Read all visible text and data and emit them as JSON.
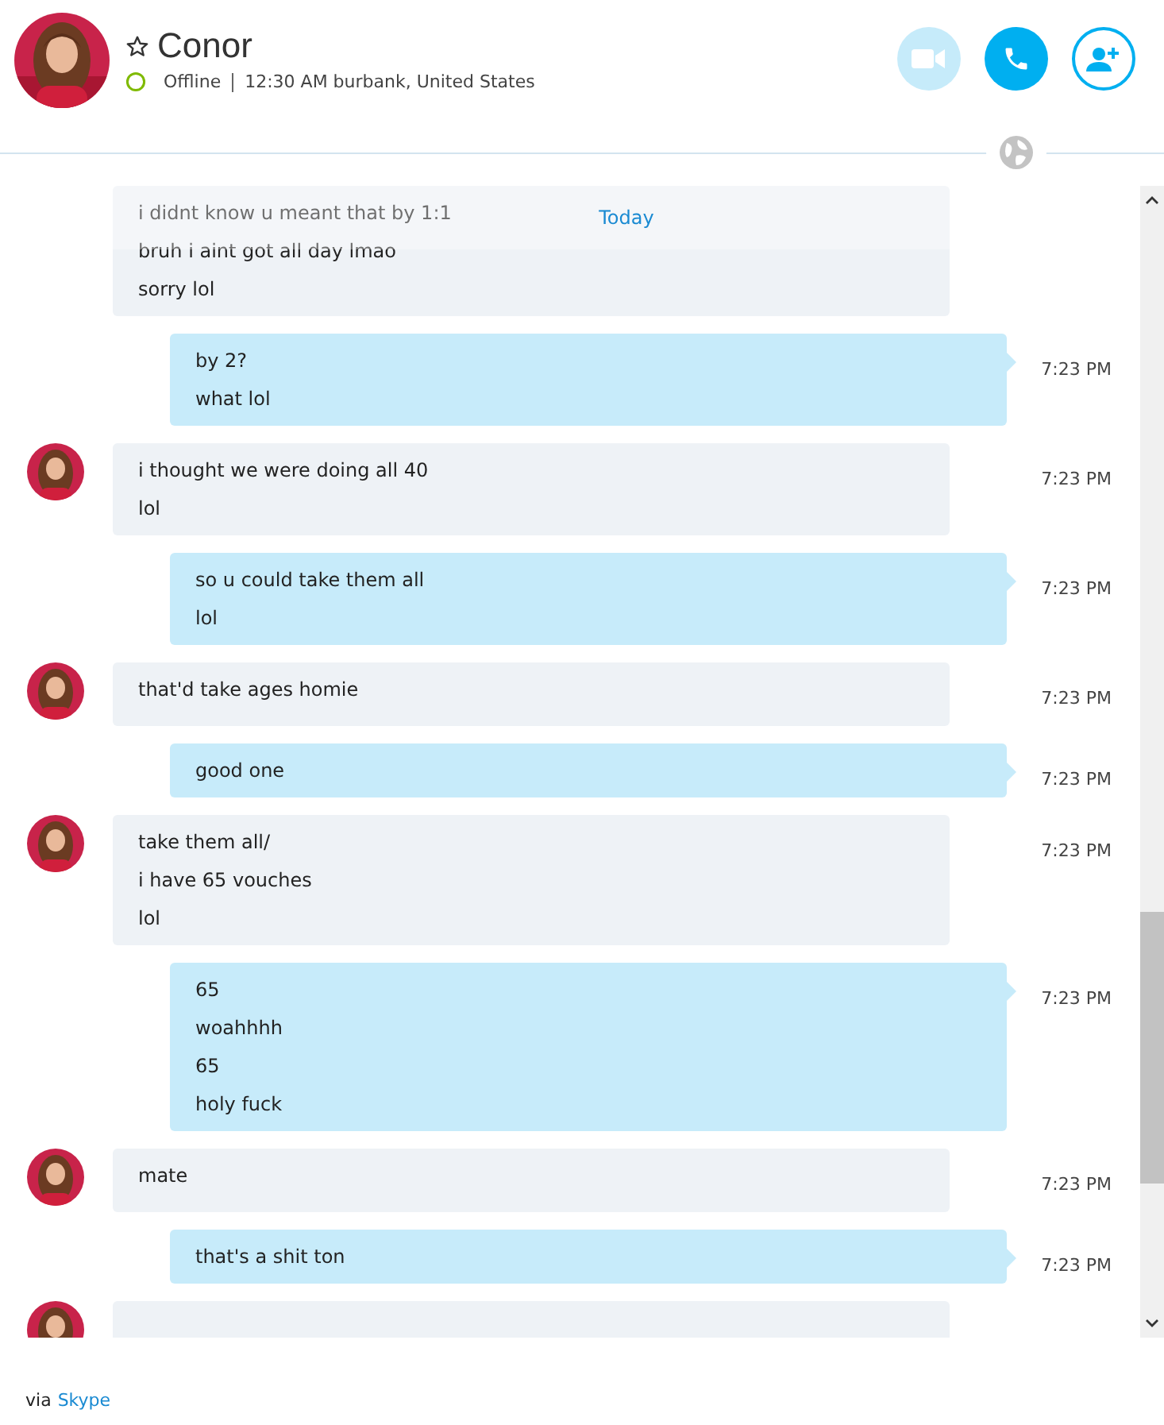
{
  "contact": {
    "name": "Conor",
    "status": "Offline",
    "details": "12:30 AM burbank, United States"
  },
  "date_divider": "Today",
  "messages": [
    {
      "kind": "received",
      "continued": true,
      "lines": [
        "i didnt know u meant that by 1:1",
        "bruh i aint got all day lmao",
        "sorry lol"
      ]
    },
    {
      "kind": "sent",
      "lines": [
        "by 2?",
        "what lol"
      ],
      "time": "7:23 PM"
    },
    {
      "kind": "received",
      "lines": [
        "i thought we were doing all 40",
        "lol"
      ],
      "time": "7:23 PM"
    },
    {
      "kind": "sent",
      "lines": [
        "so u could take them all",
        "lol"
      ],
      "time": "7:23 PM"
    },
    {
      "kind": "received",
      "lines": [
        "that'd take ages homie"
      ],
      "time": "7:23 PM"
    },
    {
      "kind": "sent",
      "lines": [
        "good one"
      ],
      "time": "7:23 PM"
    },
    {
      "kind": "received",
      "lines": [
        "take them all/",
        "i have 65 vouches",
        "lol"
      ],
      "time": "7:23 PM"
    },
    {
      "kind": "sent",
      "lines": [
        "65",
        "woahhhh",
        "65",
        "holy fuck"
      ],
      "time": "7:23 PM"
    },
    {
      "kind": "received",
      "lines": [
        "mate"
      ],
      "time": "7:23 PM"
    },
    {
      "kind": "sent",
      "lines": [
        "that's a shit ton"
      ],
      "time": "7:23 PM"
    },
    {
      "kind": "received"
    }
  ],
  "footer": {
    "prefix": "via",
    "link": "Skype"
  }
}
